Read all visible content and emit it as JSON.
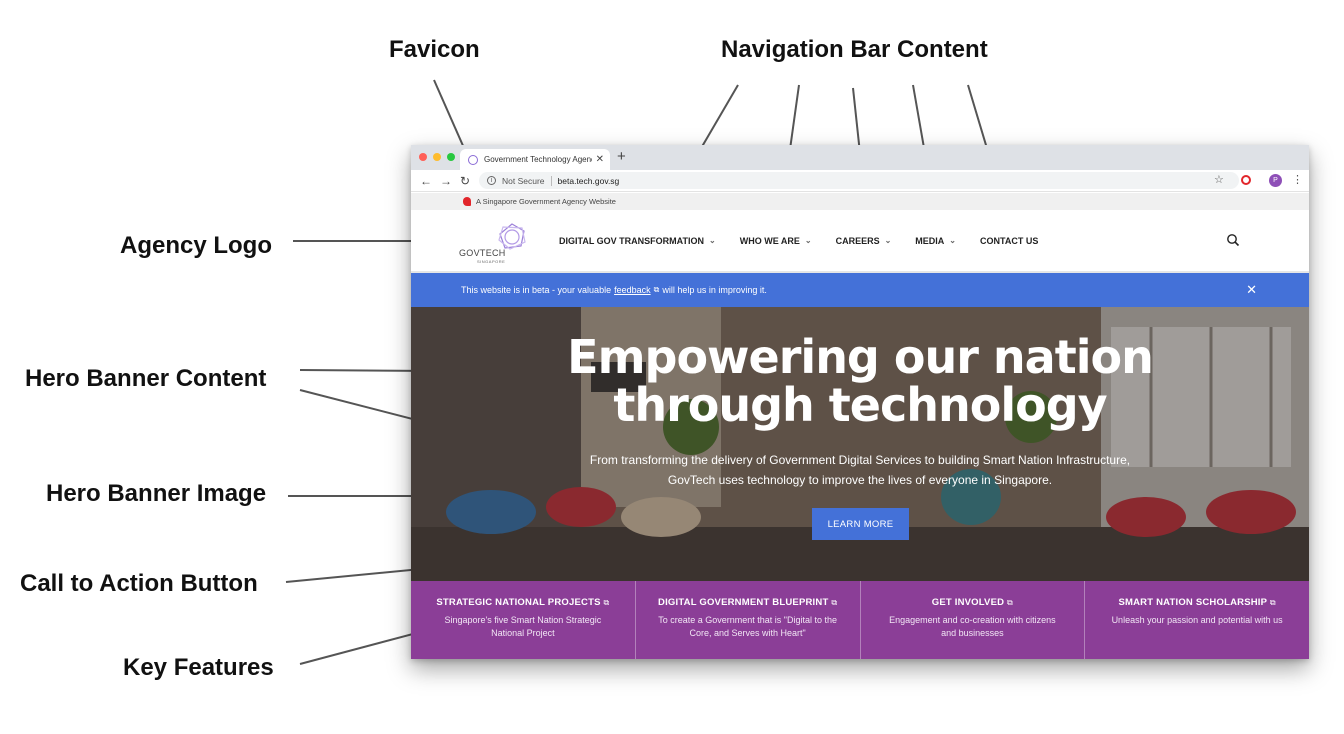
{
  "annotations": {
    "favicon": "Favicon",
    "navigation": "Navigation Bar Content",
    "agency_logo": "Agency Logo",
    "hero_content": "Hero Banner Content",
    "hero_image": "Hero Banner Image",
    "cta": "Call to Action Button",
    "key_features": "Key Features"
  },
  "browser": {
    "tab_title": "Government Technology Agency",
    "tab_close": "✕",
    "new_tab": "+",
    "security_label": "Not Secure",
    "url": "beta.tech.gov.sg",
    "profile_initial": "P"
  },
  "masthead": {
    "text": "A Singapore Government Agency Website"
  },
  "site": {
    "logo_text": "GOVTECH",
    "logo_subtext": "SINGAPORE",
    "nav": [
      {
        "label": "DIGITAL GOV TRANSFORMATION",
        "has_dropdown": true
      },
      {
        "label": "WHO WE ARE",
        "has_dropdown": true
      },
      {
        "label": "CAREERS",
        "has_dropdown": true
      },
      {
        "label": "MEDIA",
        "has_dropdown": true
      },
      {
        "label": "CONTACT US",
        "has_dropdown": false
      }
    ]
  },
  "beta_banner": {
    "text_before": "This website is in beta - your valuable",
    "link": "feedback",
    "text_after": "will help us in improving it.",
    "close": "✕"
  },
  "hero": {
    "title_line1": "Empowering our nation",
    "title_line2": "through technology",
    "description_line1": "From transforming the delivery of Government Digital Services to building Smart Nation Infrastructure,",
    "description_line2": "GovTech uses technology to improve the lives of everyone in Singapore.",
    "cta_label": "LEARN MORE"
  },
  "features": [
    {
      "title": "STRATEGIC NATIONAL PROJECTS",
      "desc": "Singapore's five Smart Nation Strategic National Project"
    },
    {
      "title": "DIGITAL GOVERNMENT BLUEPRINT",
      "desc": "To create a Government that is \"Digital to the Core, and Serves with Heart\""
    },
    {
      "title": "GET INVOLVED",
      "desc": "Engagement and co-creation with citizens and businesses"
    },
    {
      "title": "SMART NATION SCHOLARSHIP",
      "desc": "Unleash your passion and potential with us"
    }
  ],
  "colors": {
    "accent_blue": "#4471d8",
    "feature_purple": "#8b3e97",
    "brand_purple": "#8a6bd6"
  }
}
